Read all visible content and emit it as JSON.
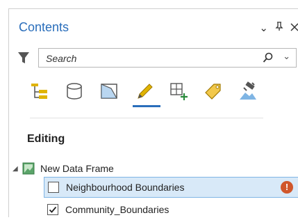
{
  "pane": {
    "title": "Contents",
    "controls": {
      "options": "⌄",
      "pin": "ᵖ",
      "close": "✕"
    }
  },
  "search": {
    "placeholder": "Search",
    "value": ""
  },
  "toolbar": {
    "tools": [
      "list-by-drawing-order-icon",
      "list-by-data-source-icon",
      "list-by-selection-icon",
      "list-by-editing-icon",
      "list-by-snapping-icon",
      "list-by-labeling-icon",
      "list-by-perspective-imagery-icon"
    ],
    "active_index": 3
  },
  "section": {
    "title": "Editing"
  },
  "tree": {
    "frame_label": "New Data Frame",
    "layers": [
      {
        "label": "Neighbourhood Boundaries",
        "checked": false,
        "selected": true,
        "warning": true
      },
      {
        "label": "Community_Boundaries",
        "checked": true,
        "selected": false,
        "warning": false
      }
    ]
  },
  "colors": {
    "accent": "#2a6ebb",
    "selection": "#d8e9f8",
    "warning": "#d0572c"
  }
}
